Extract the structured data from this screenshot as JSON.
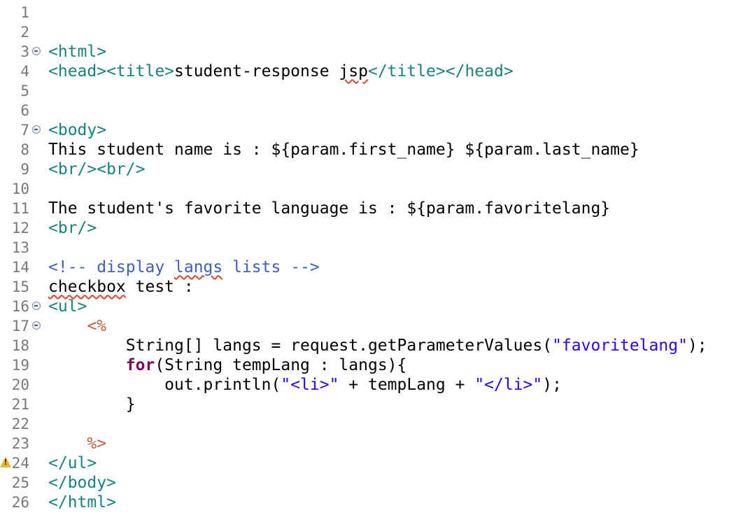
{
  "editor": {
    "lines": [
      {
        "num": "1",
        "tokens": []
      },
      {
        "num": "2",
        "tokens": []
      },
      {
        "num": "3",
        "fold": true,
        "tokens": [
          {
            "t": "<html>",
            "c": "tag"
          }
        ]
      },
      {
        "num": "4",
        "tokens": [
          {
            "t": "<head><title>",
            "c": "tag"
          },
          {
            "t": "student-response ",
            "c": "txt"
          },
          {
            "t": "jsp",
            "c": "sq"
          },
          {
            "t": "</title></head>",
            "c": "tag"
          }
        ]
      },
      {
        "num": "5",
        "tokens": []
      },
      {
        "num": "6",
        "tokens": []
      },
      {
        "num": "7",
        "fold": true,
        "tokens": [
          {
            "t": "<body>",
            "c": "tag"
          }
        ]
      },
      {
        "num": "8",
        "tokens": [
          {
            "t": "This student name is : ${param.first_name} ${param.last_name}",
            "c": "txt"
          }
        ]
      },
      {
        "num": "9",
        "tokens": [
          {
            "t": "<br/><br/>",
            "c": "tag"
          }
        ]
      },
      {
        "num": "10",
        "tokens": []
      },
      {
        "num": "11",
        "tokens": [
          {
            "t": "The student's favorite language is : ${param.favoritelang}",
            "c": "txt"
          }
        ]
      },
      {
        "num": "12",
        "tokens": [
          {
            "t": "<br/>",
            "c": "tag"
          }
        ]
      },
      {
        "num": "13",
        "tokens": []
      },
      {
        "num": "14",
        "tokens": [
          {
            "t": "<!-- display ",
            "c": "cmt"
          },
          {
            "t": "langs",
            "c": "cmt sq"
          },
          {
            "t": " lists -->",
            "c": "cmt"
          }
        ]
      },
      {
        "num": "15",
        "tokens": [
          {
            "t": "checkbox",
            "c": "sq"
          },
          {
            "t": " test :",
            "c": "txt"
          }
        ]
      },
      {
        "num": "16",
        "fold": true,
        "tokens": [
          {
            "t": "<ul>",
            "c": "tag"
          }
        ]
      },
      {
        "num": "17",
        "fold": true,
        "tokens": [
          {
            "t": "    ",
            "c": "txt"
          },
          {
            "t": "<%",
            "c": "jsp"
          }
        ]
      },
      {
        "num": "18",
        "tokens": [
          {
            "t": "        String[] langs = request.getParameterValues(",
            "c": "txt"
          },
          {
            "t": "\"favoritelang\"",
            "c": "str"
          },
          {
            "t": ");",
            "c": "txt"
          }
        ]
      },
      {
        "num": "19",
        "tokens": [
          {
            "t": "        ",
            "c": "txt"
          },
          {
            "t": "for",
            "c": "kw"
          },
          {
            "t": "(String tempLang : langs){",
            "c": "txt"
          }
        ]
      },
      {
        "num": "20",
        "tokens": [
          {
            "t": "            out.println(",
            "c": "txt"
          },
          {
            "t": "\"<li>\"",
            "c": "str"
          },
          {
            "t": " + tempLang + ",
            "c": "txt"
          },
          {
            "t": "\"</li>\"",
            "c": "str"
          },
          {
            "t": ");",
            "c": "txt"
          }
        ]
      },
      {
        "num": "21",
        "tokens": [
          {
            "t": "        }",
            "c": "txt"
          }
        ]
      },
      {
        "num": "22",
        "tokens": []
      },
      {
        "num": "23",
        "tokens": [
          {
            "t": "    ",
            "c": "txt"
          },
          {
            "t": "%>",
            "c": "jsp"
          }
        ]
      },
      {
        "num": "24",
        "warning": true,
        "tokens": [
          {
            "t": "</ul>",
            "c": "tag"
          }
        ]
      },
      {
        "num": "25",
        "tokens": [
          {
            "t": "</body>",
            "c": "tag"
          }
        ]
      },
      {
        "num": "26",
        "tokens": [
          {
            "t": "</html>",
            "c": "tag"
          }
        ]
      }
    ],
    "warning_mark": "!",
    "colors": {
      "tag": "#17827f",
      "comment": "#3f5fbf",
      "string": "#2a00ff",
      "keyword": "#7f0055",
      "jsp_delimiter": "#bf5f3f",
      "line_number": "#787878",
      "squiggle": "#e0462a"
    },
    "icons": {
      "fold": "fold-collapse-icon",
      "warning": "warning-icon"
    }
  }
}
